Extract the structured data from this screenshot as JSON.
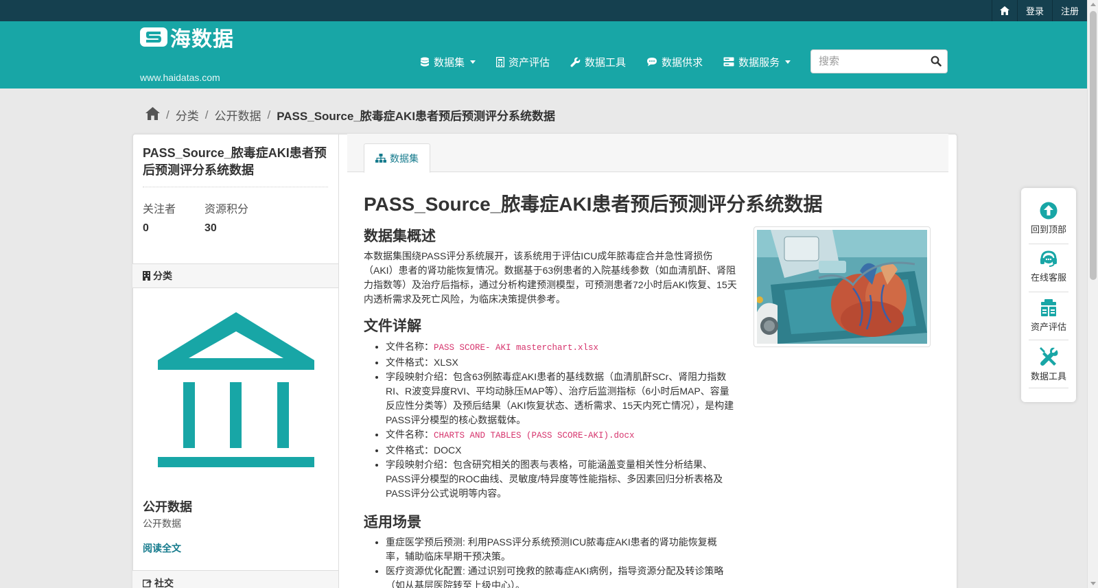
{
  "topbar": {
    "home_icon": "home-icon",
    "login": "登录",
    "register": "注册"
  },
  "header": {
    "logo_text": "海数据",
    "logo_url": "www.haidatas.com",
    "nav": [
      {
        "label": "数据集",
        "icon": "database-icon",
        "dropdown": true
      },
      {
        "label": "资产评估",
        "icon": "calculator-icon",
        "dropdown": false
      },
      {
        "label": "数据工具",
        "icon": "wrench-icon",
        "dropdown": false
      },
      {
        "label": "数据供求",
        "icon": "comment-icon",
        "dropdown": false
      },
      {
        "label": "数据服务",
        "icon": "server-icon",
        "dropdown": true
      }
    ],
    "search_placeholder": "搜索"
  },
  "breadcrumb": {
    "items": [
      "分类",
      "公开数据"
    ],
    "current": "PASS_Source_脓毒症AKI患者预后预测评分系统数据"
  },
  "sidebar": {
    "title": "PASS_Source_脓毒症AKI患者预后预测评分系统数据",
    "followers_label": "关注者",
    "followers_value": "0",
    "points_label": "资源积分",
    "points_value": "30",
    "category_heading": "分类",
    "org_title": "公开数据",
    "org_desc": "公开数据",
    "read_more": "阅读全文",
    "social_heading": "社交"
  },
  "tabs": [
    {
      "label": "数据集",
      "active": true
    }
  ],
  "content": {
    "title": "PASS_Source_脓毒症AKI患者预后预测评分系统数据",
    "overview_heading": "数据集概述",
    "overview_text": "本数据集围绕PASS评分系统展开，该系统用于评估ICU成年脓毒症合并急性肾损伤（AKI）患者的肾功能恢复情况。数据基于63例患者的入院基线参数（如血清肌酐、肾阻力指数等）及治疗后指标，通过分析构建预测模型，可预测患者72小时后AKI恢复、15天内透析需求及死亡风险，为临床决策提供参考。",
    "files_heading": "文件详解",
    "file_name_label": "文件名称：",
    "file_format_label": "文件格式：",
    "field_label": "字段映射介绍：",
    "file1_name": "PASS SCORE- AKI masterchart.xlsx",
    "file1_format": "XLSX",
    "file1_field": "包含63例脓毒症AKI患者的基线数据（血清肌酐SCr、肾阻力指数RI、R波变异度RVI、平均动脉压MAP等）、治疗后监测指标（6小时后MAP、容量反应性分类等）及预后结果（AKI恢复状态、透析需求、15天内死亡情况），是构建PASS评分模型的核心数据载体。",
    "file2_name": "CHARTS AND TABLES (PASS SCORE-AKI).docx",
    "file2_format": "DOCX",
    "file2_field": "包含研究相关的图表与表格，可能涵盖变量相关性分析结果、PASS评分模型的ROC曲线、灵敏度/特异度等性能指标、多因素回归分析表格及PASS评分公式说明等内容。",
    "scenario_heading": "适用场景",
    "scenario1": "重症医学预后预测: 利用PASS评分系统预测ICU脓毒症AKI患者的肾功能恢复概率，辅助临床早期干预决策。",
    "scenario2": "医疗资源优化配置: 通过识别可挽救的脓毒症AKI病例，指导资源分配及转诊策略（如从基层医院转至上级中心）。"
  },
  "float_tools": [
    {
      "label": "回到顶部",
      "icon": "arrow-up-circle-icon"
    },
    {
      "label": "在线客服",
      "icon": "headset-icon"
    },
    {
      "label": "资产评估",
      "icon": "assessment-icon"
    },
    {
      "label": "数据工具",
      "icon": "tools-icon"
    }
  ],
  "colors": {
    "topbar": "#15404f",
    "header": "#18a6a6",
    "accent": "#167b8d",
    "code": "#d6336c"
  }
}
